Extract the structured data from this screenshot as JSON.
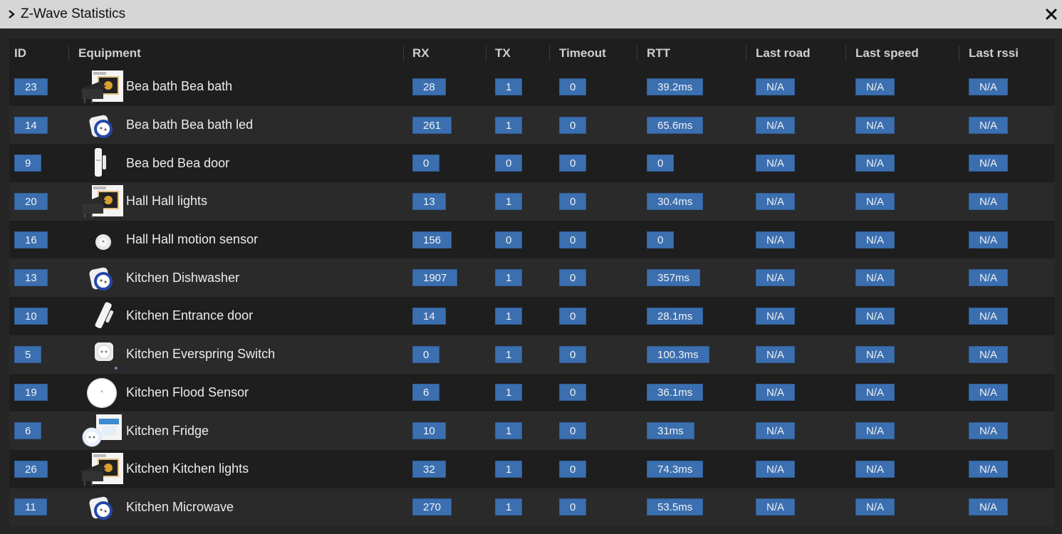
{
  "window": {
    "title": "Z-Wave Statistics"
  },
  "columns": [
    "ID",
    "Equipment",
    "RX",
    "TX",
    "Timeout",
    "RTT",
    "Last road",
    "Last speed",
    "Last rssi"
  ],
  "rows": [
    {
      "id": "23",
      "icon": "double-switch-box-icon",
      "equipment": "Bea bath Bea bath",
      "rx": "28",
      "tx": "1",
      "timeout": "0",
      "rtt": "39.2ms",
      "last_road": "N/A",
      "last_speed": "N/A",
      "last_rssi": "N/A"
    },
    {
      "id": "14",
      "icon": "wall-plug-icon",
      "equipment": "Bea bath Bea bath led",
      "rx": "261",
      "tx": "1",
      "timeout": "0",
      "rtt": "65.6ms",
      "last_road": "N/A",
      "last_speed": "N/A",
      "last_rssi": "N/A"
    },
    {
      "id": "9",
      "icon": "door-sensor-icon",
      "equipment": "Bea bed Bea door",
      "rx": "0",
      "tx": "0",
      "timeout": "0",
      "rtt": "0",
      "last_road": "N/A",
      "last_speed": "N/A",
      "last_rssi": "N/A"
    },
    {
      "id": "20",
      "icon": "double-switch-box-icon",
      "equipment": "Hall Hall lights",
      "rx": "13",
      "tx": "1",
      "timeout": "0",
      "rtt": "30.4ms",
      "last_road": "N/A",
      "last_speed": "N/A",
      "last_rssi": "N/A"
    },
    {
      "id": "16",
      "icon": "motion-sensor-icon",
      "equipment": "Hall Hall motion sensor",
      "rx": "156",
      "tx": "0",
      "timeout": "0",
      "rtt": "0",
      "last_road": "N/A",
      "last_speed": "N/A",
      "last_rssi": "N/A"
    },
    {
      "id": "13",
      "icon": "wall-plug-icon",
      "equipment": "Kitchen Dishwasher",
      "rx": "1907",
      "tx": "1",
      "timeout": "0",
      "rtt": "357ms",
      "last_road": "N/A",
      "last_speed": "N/A",
      "last_rssi": "N/A"
    },
    {
      "id": "10",
      "icon": "door-sensor-tilted-icon",
      "equipment": "Kitchen Entrance door",
      "rx": "14",
      "tx": "1",
      "timeout": "0",
      "rtt": "28.1ms",
      "last_road": "N/A",
      "last_speed": "N/A",
      "last_rssi": "N/A"
    },
    {
      "id": "5",
      "icon": "plug-switch-icon",
      "equipment": "Kitchen Everspring Switch",
      "rx": "0",
      "tx": "1",
      "timeout": "0",
      "rtt": "100.3ms",
      "last_road": "N/A",
      "last_speed": "N/A",
      "last_rssi": "N/A"
    },
    {
      "id": "19",
      "icon": "flood-sensor-icon",
      "equipment": "Kitchen Flood Sensor",
      "rx": "6",
      "tx": "1",
      "timeout": "0",
      "rtt": "36.1ms",
      "last_road": "N/A",
      "last_speed": "N/A",
      "last_rssi": "N/A"
    },
    {
      "id": "6",
      "icon": "wall-plug-box-icon",
      "equipment": "Kitchen Fridge",
      "rx": "10",
      "tx": "1",
      "timeout": "0",
      "rtt": "31ms",
      "last_road": "N/A",
      "last_speed": "N/A",
      "last_rssi": "N/A"
    },
    {
      "id": "26",
      "icon": "double-switch-box-icon",
      "equipment": "Kitchen Kitchen lights",
      "rx": "32",
      "tx": "1",
      "timeout": "0",
      "rtt": "74.3ms",
      "last_road": "N/A",
      "last_speed": "N/A",
      "last_rssi": "N/A"
    },
    {
      "id": "11",
      "icon": "wall-plug-icon",
      "equipment": "Kitchen Microwave",
      "rx": "270",
      "tx": "1",
      "timeout": "0",
      "rtt": "53.5ms",
      "last_road": "N/A",
      "last_speed": "N/A",
      "last_rssi": "N/A"
    }
  ],
  "colors": {
    "badge": "#3b6fb0",
    "titlebar": "#d6d6d6",
    "panel": "#262626"
  }
}
